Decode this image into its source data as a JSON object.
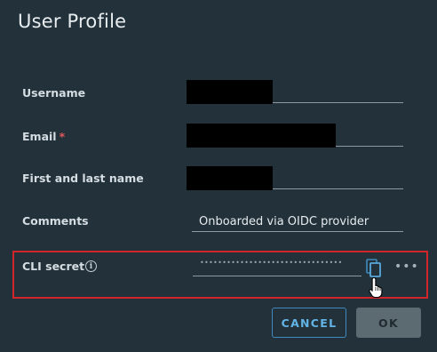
{
  "dialog": {
    "title": "User Profile"
  },
  "form": {
    "username": {
      "label": "Username",
      "value": ""
    },
    "email": {
      "label": "Email",
      "required_mark": "*",
      "value": ""
    },
    "full_name": {
      "label": "First and last name",
      "value": ""
    },
    "comments": {
      "label": "Comments",
      "value": "Onboarded via OIDC provider"
    },
    "cli_secret": {
      "label": "CLI secret",
      "masked_value": "••••••••••••••••••••••••••••••••",
      "info_icon": "info-icon",
      "copy_icon": "copy-icon",
      "more_icon": "more-horizontal-icon",
      "more_text": "•••"
    }
  },
  "footer": {
    "cancel_label": "CANCEL",
    "ok_label": "OK"
  },
  "colors": {
    "background": "#22313a",
    "accent": "#3f8bbd",
    "required": "#e05a5a",
    "highlight_border": "#d0252a",
    "disabled_button": "#5c6a72"
  }
}
